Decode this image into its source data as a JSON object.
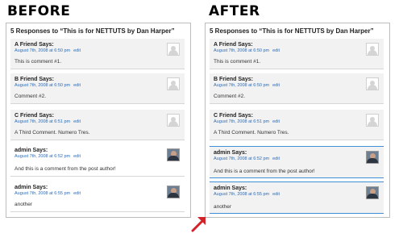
{
  "headings": {
    "before": "BEFORE",
    "after": "AFTER"
  },
  "panel_title": "5 Responses to “This is for NETTUTS by Dan Harper”",
  "edit_label": "edit",
  "comments": [
    {
      "author": "A Friend Says:",
      "date": "August 7th, 2008 at 6:50 pm",
      "text": "This is comment #1.",
      "avatar": "default"
    },
    {
      "author": "B Friend Says:",
      "date": "August 7th, 2008 at 6:50 pm",
      "text": "Comment #2.",
      "avatar": "default"
    },
    {
      "author": "C Friend Says:",
      "date": "August 7th, 2008 at 6:51 pm",
      "text": "A Third Comment. Numero Tres.",
      "avatar": "default"
    },
    {
      "author": "admin Says:",
      "date": "August 7th, 2008 at 6:52 pm",
      "text": "And this is a comment from the post author!",
      "avatar": "photo"
    },
    {
      "author": "admin Says:",
      "date": "August 7th, 2008 at 6:55 pm",
      "text": "another",
      "avatar": "photo"
    }
  ],
  "colors": {
    "link": "#2b6cb8",
    "highlight_border": "#3e8fd6",
    "arrow": "#d2232a"
  }
}
